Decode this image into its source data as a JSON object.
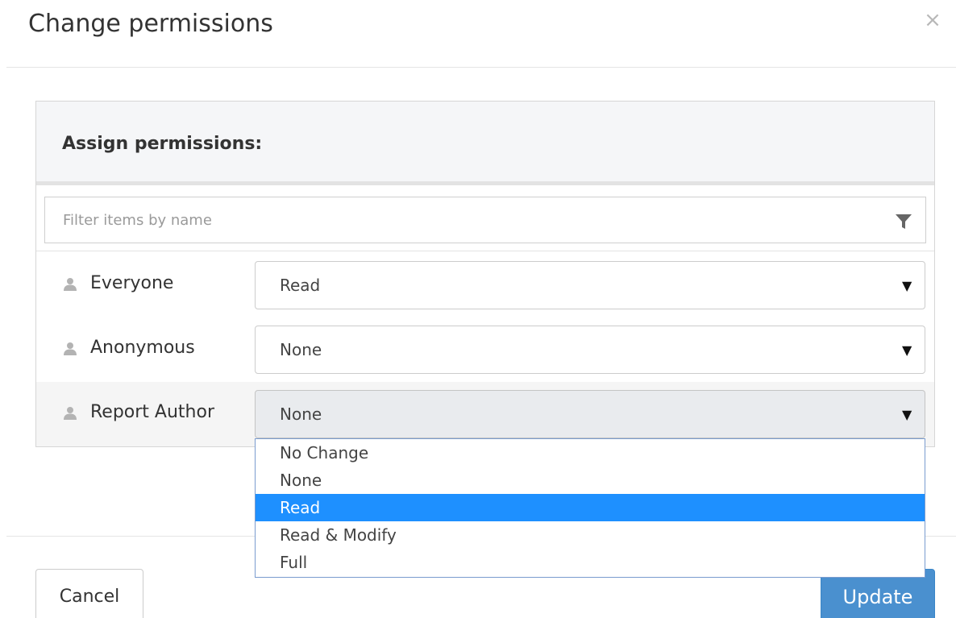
{
  "dialog": {
    "title": "Change permissions",
    "close_symbol": "×"
  },
  "panel": {
    "heading": "Assign permissions:",
    "filter": {
      "placeholder": "Filter items by name",
      "value": "",
      "icon": "filter-icon"
    }
  },
  "rows": [
    {
      "user": "Everyone",
      "icon": "user-icon",
      "permission": "Read"
    },
    {
      "user": "Anonymous",
      "icon": "user-icon",
      "permission": "None"
    },
    {
      "user": "Report Author",
      "icon": "user-icon",
      "permission": "None"
    }
  ],
  "select_caret": "▼",
  "dropdown": {
    "options": [
      "No Change",
      "None",
      "Read",
      "Read & Modify",
      "Full"
    ],
    "highlighted": "Read"
  },
  "footer": {
    "cancel_label": "Cancel",
    "update_label": "Update"
  },
  "colors": {
    "primary": "#4a90cf",
    "option_highlight": "#1e90ff",
    "panel_heading_bg": "#f5f6f8"
  }
}
